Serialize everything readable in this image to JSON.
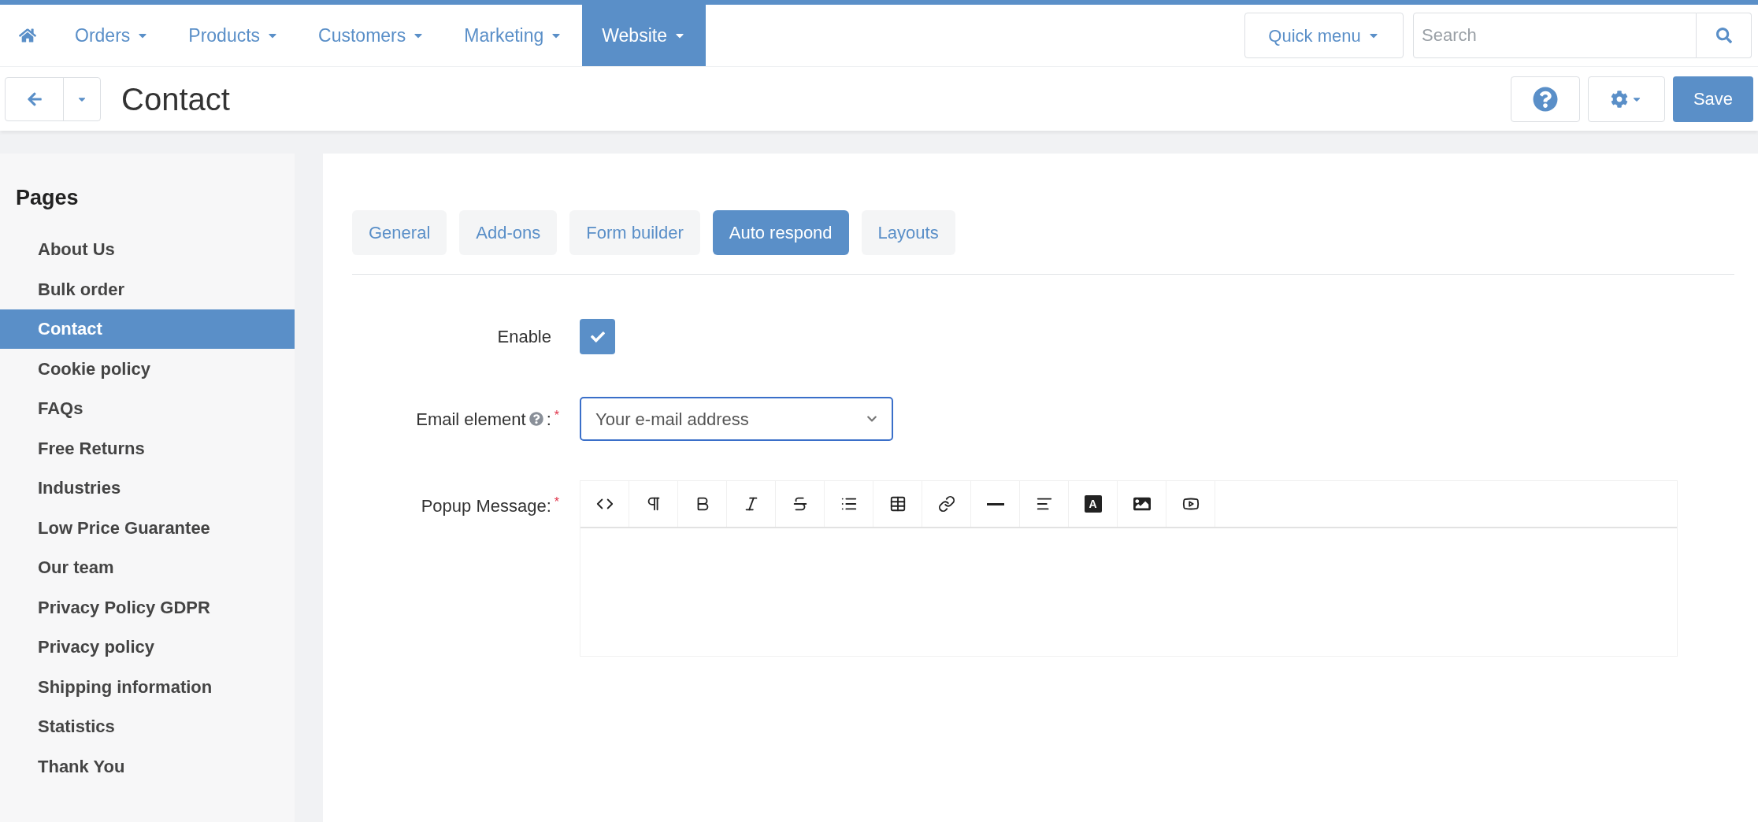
{
  "nav": {
    "items": [
      {
        "label": "Orders",
        "selected": false
      },
      {
        "label": "Products",
        "selected": false
      },
      {
        "label": "Customers",
        "selected": false
      },
      {
        "label": "Marketing",
        "selected": false
      },
      {
        "label": "Website",
        "selected": true
      }
    ],
    "quick_menu": "Quick menu",
    "search": {
      "placeholder": "Search"
    }
  },
  "header": {
    "title": "Contact",
    "save": "Save"
  },
  "sidebar": {
    "title": "Pages",
    "items": [
      {
        "label": "About Us",
        "selected": false
      },
      {
        "label": "Bulk order",
        "selected": false
      },
      {
        "label": "Contact",
        "selected": true
      },
      {
        "label": "Cookie policy",
        "selected": false
      },
      {
        "label": "FAQs",
        "selected": false
      },
      {
        "label": "Free Returns",
        "selected": false
      },
      {
        "label": "Industries",
        "selected": false
      },
      {
        "label": "Low Price Guarantee",
        "selected": false
      },
      {
        "label": "Our team",
        "selected": false
      },
      {
        "label": "Privacy Policy GDPR",
        "selected": false
      },
      {
        "label": "Privacy policy",
        "selected": false
      },
      {
        "label": "Shipping information",
        "selected": false
      },
      {
        "label": "Statistics",
        "selected": false
      },
      {
        "label": "Thank You",
        "selected": false
      }
    ]
  },
  "tabs": [
    {
      "label": "General",
      "selected": false
    },
    {
      "label": "Add-ons",
      "selected": false
    },
    {
      "label": "Form builder",
      "selected": false
    },
    {
      "label": "Auto respond",
      "selected": true
    },
    {
      "label": "Layouts",
      "selected": false
    }
  ],
  "form": {
    "enable": {
      "label": "Enable",
      "checked": true
    },
    "email_element": {
      "label": "Email element",
      "suffix": ":",
      "required": "*",
      "value": "Your e-mail address"
    },
    "popup_message": {
      "label": "Popup Message:",
      "required": "*",
      "toolbar": [
        {
          "kind": "code"
        },
        {
          "kind": "paragraph"
        },
        {
          "kind": "bold"
        },
        {
          "kind": "italic"
        },
        {
          "kind": "strike"
        },
        {
          "kind": "list"
        },
        {
          "kind": "table"
        },
        {
          "kind": "link"
        },
        {
          "kind": "rule"
        },
        {
          "kind": "align"
        },
        {
          "kind": "color",
          "glyph": "A"
        },
        {
          "kind": "image"
        },
        {
          "kind": "video"
        }
      ]
    }
  }
}
